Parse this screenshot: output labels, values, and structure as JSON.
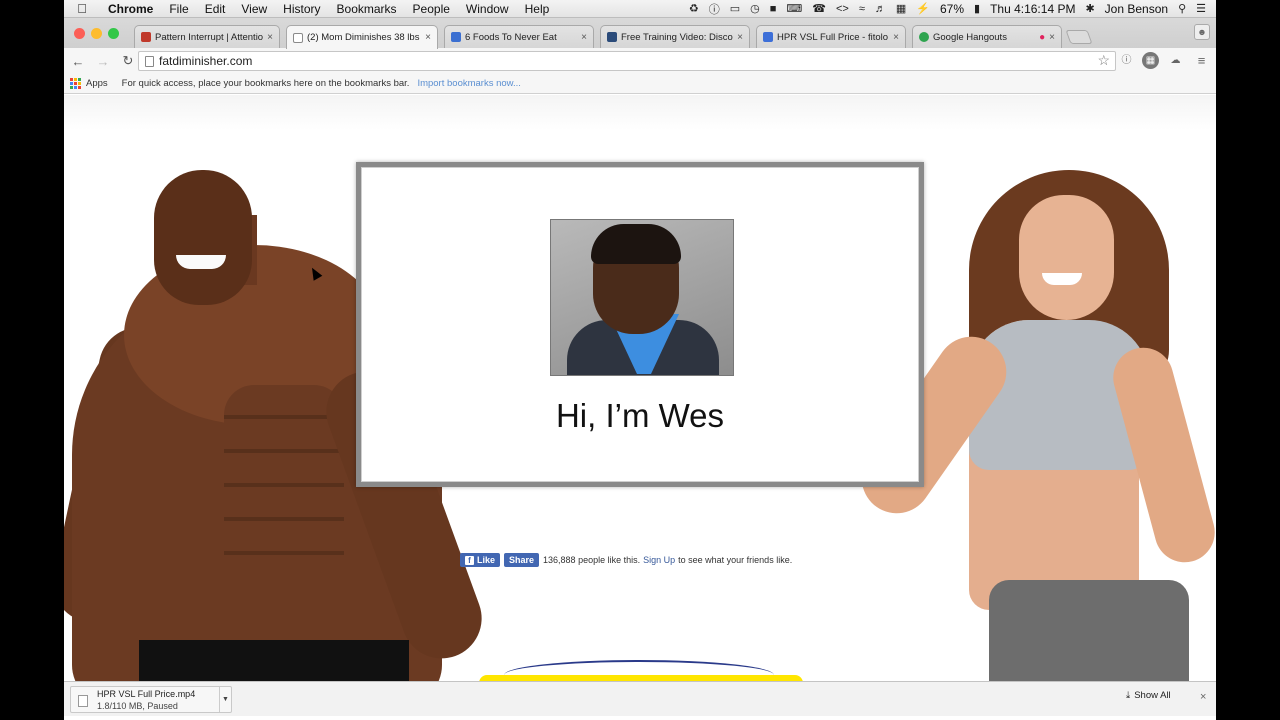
{
  "menubar": {
    "app": "Chrome",
    "items": [
      "File",
      "Edit",
      "View",
      "History",
      "Bookmarks",
      "People",
      "Window",
      "Help"
    ],
    "battery": "67%",
    "clock": "Thu 4:16:14 PM",
    "user": "Jon Benson"
  },
  "tabs": [
    {
      "title": "Pattern Interrupt | Attention",
      "favicon_color": "#c0392b"
    },
    {
      "title": "(2) Mom Diminishes 38 lbs",
      "favicon_color": "#8a8a8a"
    },
    {
      "title": "6 Foods To Never Eat",
      "favicon_color": "#3b6fd1"
    },
    {
      "title": "Free Training Video: Disco",
      "favicon_color": "#2b4b7a"
    },
    {
      "title": "HPR VSL Full Price - fitolo",
      "favicon_color": "#3d6fd8"
    },
    {
      "title": "Google Hangouts",
      "favicon_color": "#2ea44f"
    }
  ],
  "toolbar": {
    "url": "fatdiminisher.com"
  },
  "bookmarks": {
    "apps_label": "Apps",
    "hint": "For quick access, place your bookmarks here on the bookmarks bar.",
    "import_link": "Import bookmarks now..."
  },
  "video": {
    "caption": "Hi, I’m Wes"
  },
  "facebook": {
    "like_label": "Like",
    "share_label": "Share",
    "count_text": "136,888 people like this.",
    "signup_label": "Sign Up",
    "suffix_text": "to see what your friends like."
  },
  "downloads": {
    "filename": "HPR VSL Full Price.mp4",
    "status": "1.8/110 MB, Paused",
    "show_all_label": "Show All"
  }
}
